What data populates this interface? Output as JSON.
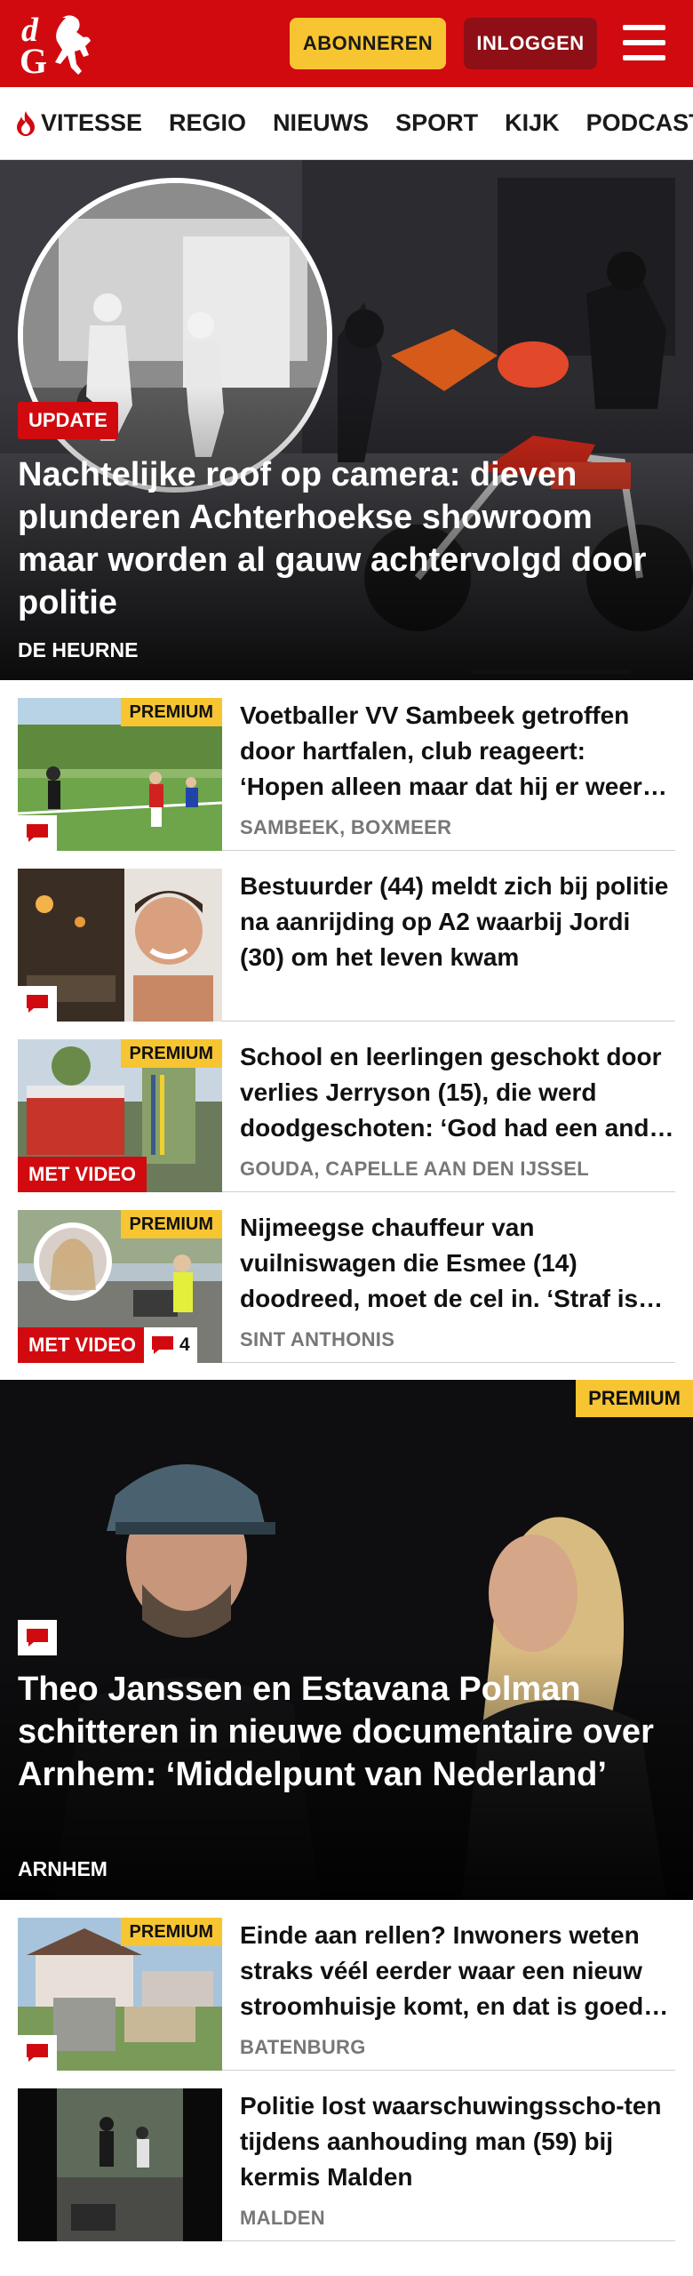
{
  "header": {
    "subscribe_label": "ABONNEREN",
    "login_label": "INLOGGEN",
    "logo_letters": "dG",
    "brand_color": "#d10a10"
  },
  "nav": {
    "items": [
      {
        "label": "VITESSE",
        "icon": "flame-icon"
      },
      {
        "label": "REGIO"
      },
      {
        "label": "NIEUWS"
      },
      {
        "label": "SPORT"
      },
      {
        "label": "KIJK"
      },
      {
        "label": "PODCAST"
      }
    ]
  },
  "hero": {
    "tag": "UPDATE",
    "title": "Nachtelijke roof op camera: dieven plunderen Achterhoekse showroom maar worden al gauw achtervolgd door politie",
    "location": "DE HEURNE"
  },
  "articles": [
    {
      "title": "Voetballer VV Sambeek getroffen door hartfalen, club reageert: ‘Hopen alleen maar dat hij er weer bovenop komt’",
      "location": "SAMBEEK, BOXMEER",
      "premium": "PREMIUM"
    },
    {
      "title": "Bestuurder (44) meldt zich bij politie na aanrijding op A2 waarbij Jordi (30) om het leven kwam",
      "location": ""
    },
    {
      "title": "School en leerlingen geschokt door verlies Jerryson (15), die werd doodgeschoten: ‘God had een ander plan’",
      "location": "GOUDA, CAPELLE AAN DEN IJSSEL",
      "premium": "PREMIUM",
      "video": "MET VIDEO"
    },
    {
      "title": "Nijmeegse chauffeur van vuilniswagen die Esmee (14) doodreed, moet de cel in. ‘Straf is onvoldoende’",
      "location": "SINT ANTHONIS",
      "premium": "PREMIUM",
      "video": "MET VIDEO",
      "comments": "4"
    }
  ],
  "feature": {
    "premium": "PREMIUM",
    "title": "Theo Janssen en Estavana Polman schitteren in nieuwe documentaire over Arnhem: ‘Middelpunt van Nederland’",
    "location": "ARNHEM"
  },
  "articles2": [
    {
      "title": "Einde aan rellen? Inwoners weten straks véél eerder waar een nieuw stroomhuisje komt, en dat is goed nieuws",
      "location": "BATENBURG",
      "premium": "PREMIUM"
    },
    {
      "title": "Politie lost waarschuwingsscho-ten tijdens aanhouding man (59) bij kermis Malden",
      "location": "MALDEN"
    }
  ]
}
